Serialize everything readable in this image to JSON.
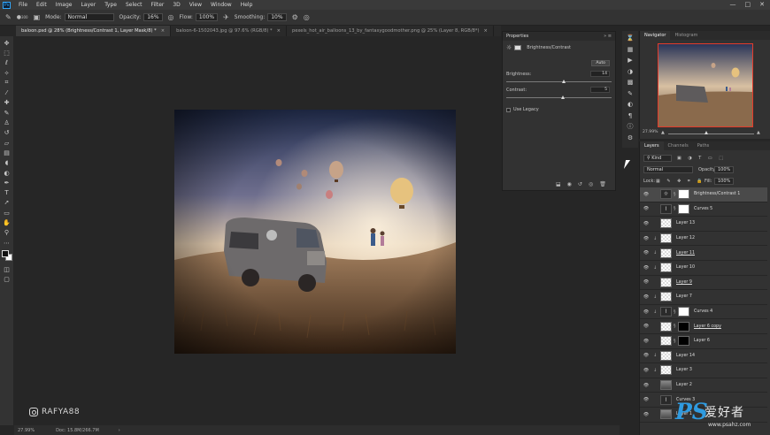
{
  "menu": [
    "File",
    "Edit",
    "Image",
    "Layer",
    "Type",
    "Select",
    "Filter",
    "3D",
    "View",
    "Window",
    "Help"
  ],
  "window_controls": {
    "minimize": "—",
    "maximize": "□",
    "close": "✕"
  },
  "options_bar": {
    "brush_size": "300",
    "mode_label": "Mode:",
    "mode_value": "Normal",
    "opacity_label": "Opacity:",
    "opacity_value": "16%",
    "flow_label": "Flow:",
    "flow_value": "100%",
    "smoothing_label": "Smoothing:",
    "smoothing_value": "10%"
  },
  "tabs": [
    {
      "label": "baloon.psd @ 28% (Brightness/Contrast 1, Layer Mask/8) *",
      "active": true
    },
    {
      "label": "baloon-6-1502043.jpg @ 97.6% (RGB/8) *",
      "active": false
    },
    {
      "label": "pexels_hot_air_balloons_13_by_fantasygoodmother.png @ 25% (Layer 8, RGB/8*)",
      "active": false
    }
  ],
  "properties": {
    "title": "Properties",
    "adjustment_name": "Brightness/Contrast",
    "auto_label": "Auto",
    "brightness_label": "Brightness:",
    "brightness_value": "14",
    "contrast_label": "Contrast:",
    "contrast_value": "5",
    "legacy_label": "Use Legacy"
  },
  "navigator": {
    "tab_navigator": "Navigator",
    "tab_histogram": "Histogram",
    "zoom": "27.99%"
  },
  "layers_panel": {
    "tab_layers": "Layers",
    "tab_channels": "Channels",
    "tab_paths": "Paths",
    "kind_label": "Kind",
    "blend_mode": "Normal",
    "opacity_label": "Opacity:",
    "opacity_value": "100%",
    "lock_label": "Lock:",
    "fill_label": "Fill:",
    "fill_value": "100%",
    "layers": [
      {
        "name": "Brightness/Contrast 1",
        "type": "adjustment",
        "icon": "☼",
        "mask": "white",
        "selected": true,
        "underline": false,
        "clipped": false
      },
      {
        "name": "Curves 5",
        "type": "adjustment",
        "icon": "⌇",
        "mask": "white",
        "selected": false,
        "underline": false,
        "clipped": false
      },
      {
        "name": "Layer 13",
        "type": "pixel",
        "mask": "",
        "selected": false,
        "underline": false,
        "clipped": false
      },
      {
        "name": "Layer 12",
        "type": "pixel",
        "mask": "",
        "selected": false,
        "underline": false,
        "clipped": true
      },
      {
        "name": "Layer 11",
        "type": "pixel",
        "mask": "",
        "selected": false,
        "underline": true,
        "clipped": true
      },
      {
        "name": "Layer 10",
        "type": "pixel",
        "mask": "",
        "selected": false,
        "underline": false,
        "clipped": true
      },
      {
        "name": "Layer 9",
        "type": "pixel",
        "mask": "",
        "selected": false,
        "underline": true,
        "clipped": false
      },
      {
        "name": "Layer 7",
        "type": "pixel",
        "mask": "",
        "selected": false,
        "underline": false,
        "clipped": true
      },
      {
        "name": "Curves 4",
        "type": "adjustment",
        "icon": "⌇",
        "mask": "white",
        "selected": false,
        "underline": false,
        "clipped": true
      },
      {
        "name": "Layer 6 copy",
        "type": "pixel",
        "mask": "black",
        "selected": false,
        "underline": true,
        "clipped": false
      },
      {
        "name": "Layer 6",
        "type": "pixel",
        "mask": "black",
        "selected": false,
        "underline": false,
        "clipped": false
      },
      {
        "name": "Layer 14",
        "type": "pixel",
        "mask": "",
        "selected": false,
        "underline": false,
        "clipped": true
      },
      {
        "name": "Layer 3",
        "type": "pixel",
        "mask": "",
        "selected": false,
        "underline": false,
        "clipped": true
      },
      {
        "name": "Layer 2",
        "type": "image",
        "mask": "",
        "selected": false,
        "underline": false,
        "clipped": false
      },
      {
        "name": "Curves 3",
        "type": "adjustment",
        "icon": "⌇",
        "mask": "",
        "selected": false,
        "underline": false,
        "clipped": false
      },
      {
        "name": "Layer 1",
        "type": "image",
        "mask": "",
        "selected": false,
        "underline": false,
        "clipped": false
      }
    ]
  },
  "statusbar": {
    "zoom": "27.99%",
    "doc": "Doc: 15.8M/266.7M"
  },
  "watermark": {
    "handle": "RAFYA88"
  },
  "site_badge": {
    "logo": "PS",
    "cn": "爱好者",
    "url": "www.psahz.com"
  },
  "colors": {
    "accent_red": "#e43b2b",
    "ps_blue": "#31a8ff"
  },
  "icons": {
    "tools": [
      "move-icon",
      "marquee-icon",
      "lasso-icon",
      "magic-wand-icon",
      "crop-icon",
      "eyedropper-icon",
      "healing-icon",
      "brush-icon",
      "stamp-icon",
      "history-brush-icon",
      "eraser-icon",
      "gradient-icon",
      "blur-icon",
      "dodge-icon",
      "pen-icon",
      "type-icon",
      "path-select-icon",
      "shape-icon",
      "hand-icon",
      "zoom-icon",
      "more-icon"
    ]
  }
}
